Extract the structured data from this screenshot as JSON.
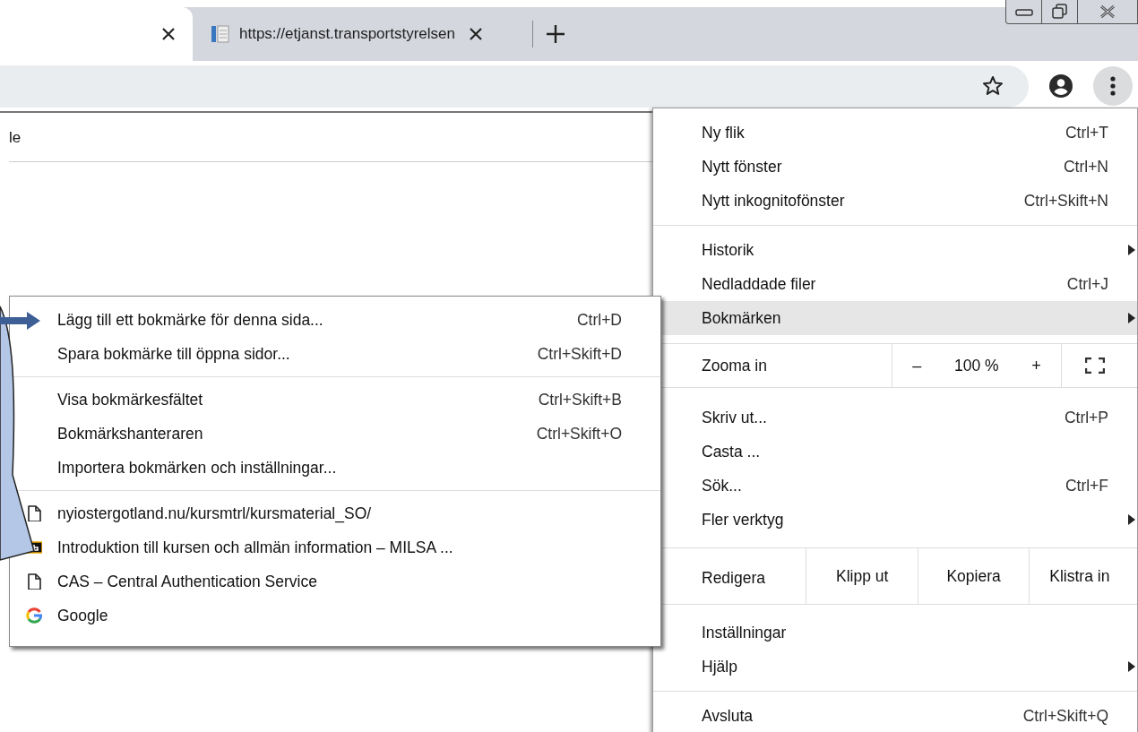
{
  "tabs": [
    {
      "selected": true
    },
    {
      "selected": false,
      "title": "https://etjanst.transportstyrelsen"
    }
  ],
  "page": {
    "text": "le"
  },
  "menu": {
    "items": [
      {
        "kind": "item",
        "label": "Ny flik",
        "shortcut": "Ctrl+T",
        "has_submenu": false,
        "highlighted": false
      },
      {
        "kind": "item",
        "label": "Nytt fönster",
        "shortcut": "Ctrl+N",
        "has_submenu": false,
        "highlighted": false
      },
      {
        "kind": "item",
        "label": "Nytt inkognitofönster",
        "shortcut": "Ctrl+Skift+N",
        "has_submenu": false,
        "highlighted": false
      },
      {
        "kind": "separator"
      },
      {
        "kind": "item",
        "label": "Historik",
        "has_submenu": true,
        "highlighted": false
      },
      {
        "kind": "item",
        "label": "Nedladdade filer",
        "shortcut": "Ctrl+J",
        "has_submenu": false,
        "highlighted": false
      },
      {
        "kind": "item",
        "label": "Bokmärken",
        "has_submenu": true,
        "highlighted": true
      },
      {
        "kind": "zoom",
        "label": "Zooma in",
        "minus": "–",
        "value": "100 %",
        "plus": "+"
      },
      {
        "kind": "item",
        "label": "Skriv ut...",
        "shortcut": "Ctrl+P",
        "has_submenu": false,
        "highlighted": false
      },
      {
        "kind": "item",
        "label": "Casta ...",
        "has_submenu": false,
        "highlighted": false
      },
      {
        "kind": "item",
        "label": "Sök...",
        "shortcut": "Ctrl+F",
        "has_submenu": false,
        "highlighted": false
      },
      {
        "kind": "item",
        "label": "Fler verktyg",
        "has_submenu": true,
        "highlighted": false
      },
      {
        "kind": "edit",
        "label": "Redigera",
        "buttons": [
          "Klipp ut",
          "Kopiera",
          "Klistra in"
        ]
      },
      {
        "kind": "item",
        "label": "Inställningar",
        "has_submenu": false,
        "highlighted": false
      },
      {
        "kind": "item",
        "label": "Hjälp",
        "has_submenu": true,
        "highlighted": false
      },
      {
        "kind": "separator"
      },
      {
        "kind": "item",
        "label": "Avsluta",
        "shortcut": "Ctrl+Skift+Q",
        "has_submenu": false,
        "highlighted": false
      }
    ]
  },
  "submenu": {
    "items": [
      {
        "kind": "item",
        "label": "Lägg till ett bokmärke för denna sida...",
        "shortcut": "Ctrl+D"
      },
      {
        "kind": "item",
        "label": "Spara bokmärke till öppna sidor...",
        "shortcut": "Ctrl+Skift+D"
      },
      {
        "kind": "separator"
      },
      {
        "kind": "item",
        "label": "Visa bokmärkesfältet",
        "shortcut": "Ctrl+Skift+B"
      },
      {
        "kind": "item",
        "label": "Bokmärkshanteraren",
        "shortcut": "Ctrl+Skift+O"
      },
      {
        "kind": "item",
        "label": "Importera bokmärken och inställningar..."
      },
      {
        "kind": "separator"
      },
      {
        "kind": "page_bookmark",
        "label": "nyiostergotland.nu/kursmtrl/kursmaterial_SO/"
      },
      {
        "kind": "logo_bookmark",
        "label": "Introduktion till kursen och allmän information – MILSA ..."
      },
      {
        "kind": "page_bookmark",
        "label": "CAS – Central Authentication Service"
      },
      {
        "kind": "google_bookmark",
        "label": "Google"
      }
    ]
  }
}
